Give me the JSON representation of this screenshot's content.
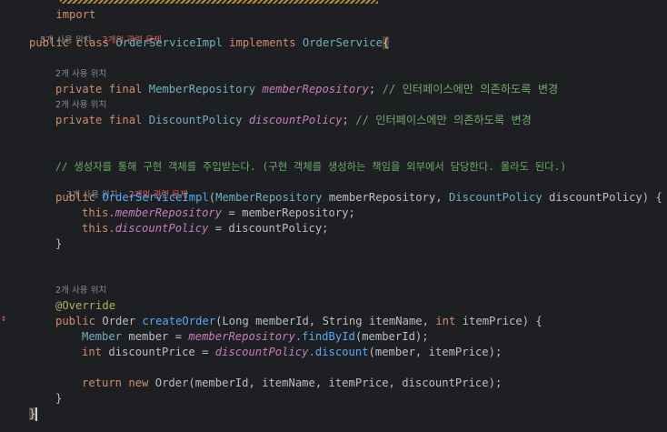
{
  "top_import_fragment": "import ",
  "class_hint": {
    "usages": "5개 사용 위치",
    "related": "2개의 관련 문제"
  },
  "class_decl": {
    "kw_public": "public",
    "kw_class": "class",
    "name": "OrderServiceImpl",
    "kw_implements": "implements",
    "iface": "OrderService",
    "brace": "{"
  },
  "field1_hint": "2개 사용 위치",
  "field1": {
    "mods": "private final",
    "type": "MemberRepository",
    "name": "memberRepository",
    "semi": ";",
    "comment": "// 인터페이스에만 의존하도록 변경"
  },
  "field2_hint": "2개 사용 위치",
  "field2": {
    "mods": "private final",
    "type": "DiscountPolicy",
    "name": "discountPolicy",
    "semi": ";",
    "comment": "// 인터페이스에만 의존하도록 변경"
  },
  "ctor_comment": "// 생성자를 통해 구현 객체를 주입받는다. (구현 객체를 생성하는 책임을 외부에서 담당한다. 몰라도 된다.)",
  "ctor_hint": {
    "usages": "3개 사용 위치",
    "related": "2개의 관련 문제"
  },
  "ctor": {
    "kw_public": "public",
    "name": "OrderServiceImpl",
    "p1_type": "MemberRepository",
    "p1_name": "memberRepository",
    "p2_type": "DiscountPolicy",
    "p2_name": "discountPolicy",
    "open": ") {"
  },
  "ctor_body": [
    {
      "this": "this.",
      "field": "memberRepository",
      "rest": " = memberRepository;"
    },
    {
      "this": "this.",
      "field": "discountPolicy",
      "rest": " = discountPolicy;"
    }
  ],
  "close_brace": "}",
  "method_hint": "2개 사용 위치",
  "annotation": "@Override",
  "method": {
    "kw_public": "public",
    "ret": "Order",
    "name": "createOrder",
    "p1_type": "Long",
    "p1_name": "memberId",
    "p2_type": "String",
    "p2_name": "itemName",
    "p3_type": "int",
    "p3_name": "itemPrice",
    "open": ") {"
  },
  "m_line1": {
    "type": "Member",
    "var": "member",
    "eq": " = ",
    "field": "memberRepository",
    "call": ".findById",
    "args": "(memberId);"
  },
  "m_line2": {
    "type": "int",
    "var": "discountPrice",
    "eq": " = ",
    "field": "discountPolicy",
    "call": ".discount",
    "args": "(member, itemPrice);"
  },
  "m_line3": {
    "kw_return": "return",
    "kw_new": "new",
    "cls": "Order",
    "args": "(memberId, itemName, itemPrice, discountPrice);"
  },
  "class_close": "}"
}
